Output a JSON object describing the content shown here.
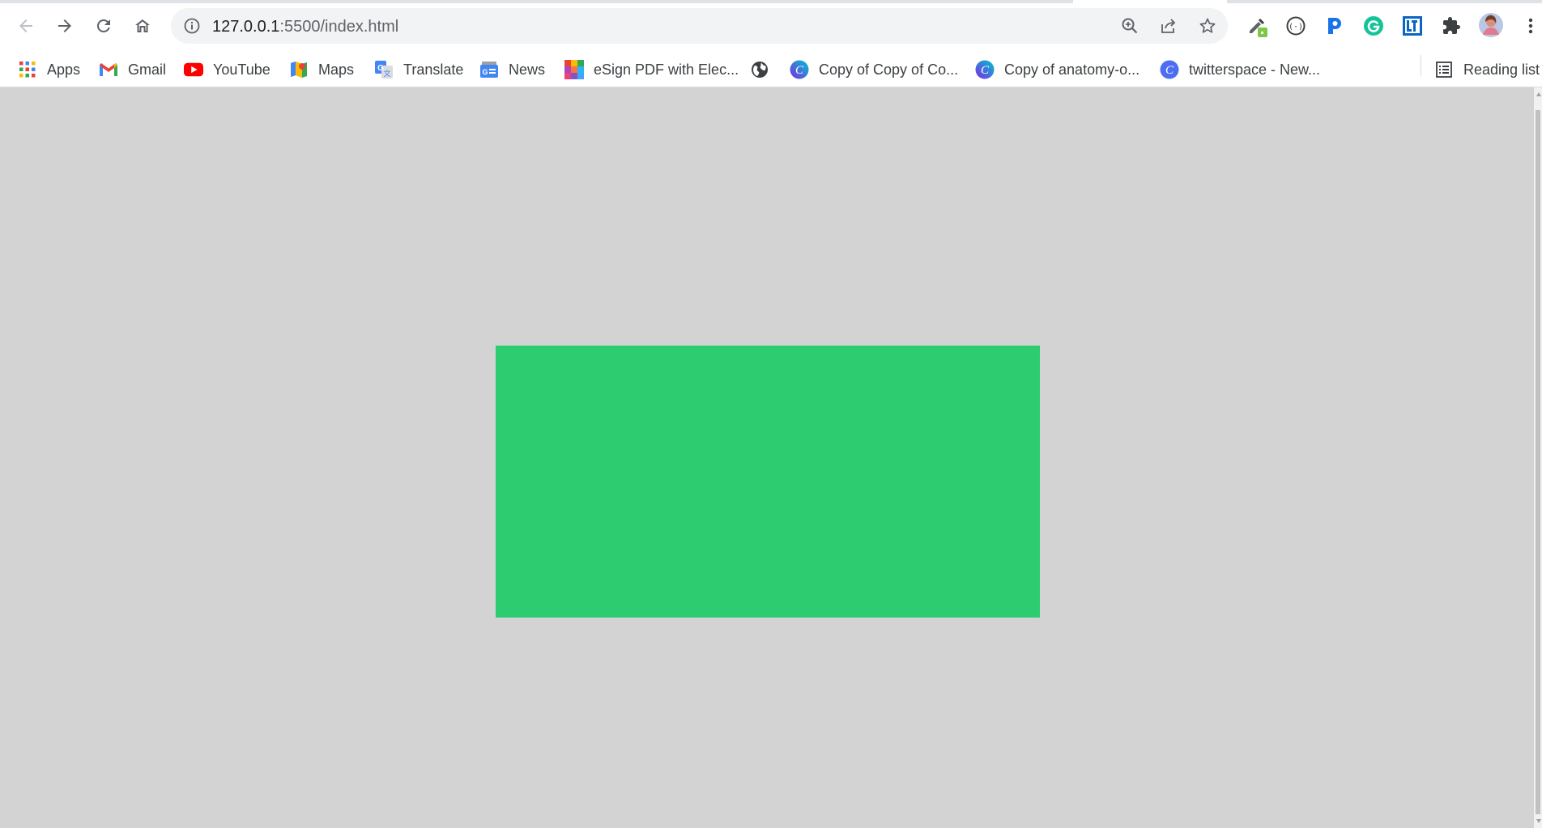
{
  "browser": {
    "url_host": "127.0.0.1",
    "url_path": ":5500/index.html",
    "icons": {
      "back": "arrow-left-icon",
      "forward": "arrow-right-icon",
      "reload": "reload-icon",
      "home": "home-icon",
      "site_info": "info-icon",
      "zoom": "zoom-in-icon",
      "share": "share-icon",
      "bookmark": "star-icon",
      "extensions": "puzzle-icon",
      "menu": "kebab-menu-icon"
    }
  },
  "bookmarks": [
    {
      "label": "Apps",
      "icon": "apps-grid-icon"
    },
    {
      "label": "Gmail",
      "icon": "gmail-icon"
    },
    {
      "label": "YouTube",
      "icon": "youtube-icon"
    },
    {
      "label": "Maps",
      "icon": "maps-icon"
    },
    {
      "label": "Translate",
      "icon": "translate-icon"
    },
    {
      "label": "News",
      "icon": "news-icon"
    },
    {
      "label": "eSign PDF with Elec...",
      "icon": "esign-icon"
    },
    {
      "label": "",
      "icon": "globe-icon"
    },
    {
      "label": "Copy of Copy of Co...",
      "icon": "canva-icon"
    },
    {
      "label": "Copy of anatomy-o...",
      "icon": "canva-icon"
    },
    {
      "label": "twitterspace - New...",
      "icon": "canva-icon"
    }
  ],
  "reading_list": {
    "label": "Reading list",
    "icon": "reading-list-icon"
  },
  "page": {
    "background_color": "#d3d3d3",
    "box_color": "#2ecc71"
  }
}
